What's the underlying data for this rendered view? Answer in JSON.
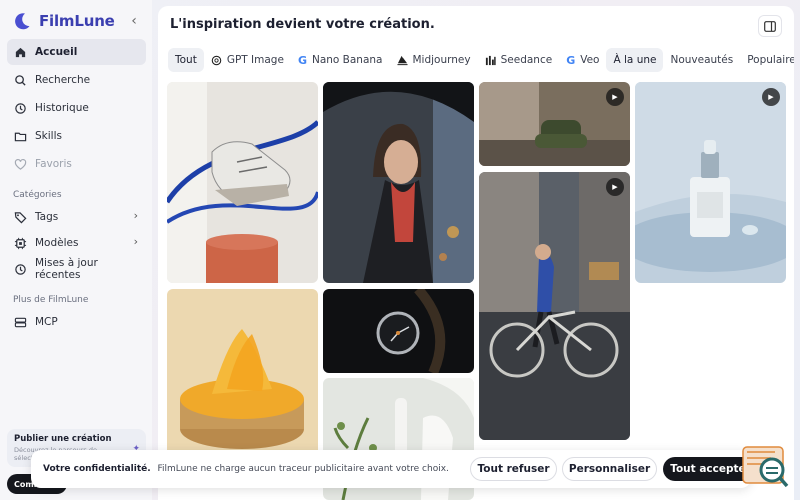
{
  "app": {
    "name": "FilmLune"
  },
  "sidebar": {
    "collapse_glyph": "‹",
    "items": [
      {
        "label": "Accueil",
        "icon": "home-icon"
      },
      {
        "label": "Recherche",
        "icon": "search-icon"
      },
      {
        "label": "Historique",
        "icon": "history-icon"
      },
      {
        "label": "Skills",
        "icon": "folder-icon"
      },
      {
        "label": "Favoris",
        "icon": "heart-icon"
      }
    ],
    "categories_label": "Catégories",
    "category_items": [
      {
        "label": "Tags",
        "icon": "tag-icon"
      },
      {
        "label": "Modèles",
        "icon": "chip-icon"
      },
      {
        "label": "Mises à jour récentes",
        "icon": "clock-icon"
      }
    ],
    "more_label": "Plus de FilmLune",
    "more_items": [
      {
        "label": "MCP",
        "icon": "server-icon"
      }
    ],
    "publish": {
      "title": "Publier une création",
      "desc": "Découvrez le parcours de sélect…",
      "icon": "sparkle-icon"
    },
    "connect_label": "Com…"
  },
  "main": {
    "title": "L'inspiration devient votre création.",
    "tabs": [
      {
        "label": "Tout",
        "icon": ""
      },
      {
        "label": "GPT Image",
        "icon": "openai-icon"
      },
      {
        "label": "Nano Banana",
        "icon": "google-icon"
      },
      {
        "label": "Midjourney",
        "icon": "midjourney-icon"
      },
      {
        "label": "Seedance",
        "icon": "seedance-icon"
      },
      {
        "label": "Veo",
        "icon": "google-icon"
      },
      {
        "label": "À la une",
        "icon": ""
      },
      {
        "label": "Nouveautés",
        "icon": ""
      },
      {
        "label": "Populaires",
        "icon": ""
      }
    ],
    "active_tab": "À la une"
  },
  "gallery": [
    {
      "subject": "sneaker-image",
      "video": false
    },
    {
      "subject": "woman-umbrella-image",
      "video": false
    },
    {
      "subject": "green-chair-image",
      "video": true
    },
    {
      "subject": "serum-bottle-image",
      "video": true
    },
    {
      "subject": "cyclist-image",
      "video": true
    },
    {
      "subject": "orange-tart-image",
      "video": false
    },
    {
      "subject": "watch-image",
      "video": false
    },
    {
      "subject": "white-vases-image",
      "video": false
    }
  ],
  "cookie": {
    "title": "Votre confidentialité.",
    "text": "FilmLune ne charge aucun traceur publicitaire avant votre choix.",
    "refuse": "Tout refuser",
    "customize": "Personnaliser",
    "accept": "Tout accepter"
  },
  "colors": {
    "brand": "#3b3fb0",
    "dark_button": "#15171d",
    "feedback": "#e08a3c"
  }
}
